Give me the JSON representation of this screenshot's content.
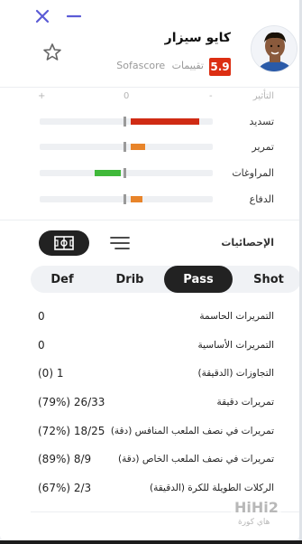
{
  "header": {
    "player_name": "كايو سيزار",
    "rating": "5.9",
    "rating_label": "تقييمات",
    "rating_source": "Sofascore"
  },
  "colors": {
    "rating_badge": "#dc2e12",
    "positive_bar": "#d02b14",
    "mid_bar": "#e8842a",
    "green_bar": "#40b93a",
    "accent": "#5b5bd6"
  },
  "axis": {
    "plus": "+",
    "zero": "0",
    "minus": "-",
    "title": "التأثير"
  },
  "pitch_stats": [
    {
      "label": "تسديد",
      "side": "positive",
      "value": 0.8
    },
    {
      "label": "تمرير",
      "side": "positive",
      "value": 0.17
    },
    {
      "label": "المراوغات",
      "side": "negative",
      "value": 0.3
    },
    {
      "label": "الدفاع",
      "side": "positive",
      "value": 0.14
    }
  ],
  "stats_section": {
    "title": "الإحصائيات",
    "view_toggle": [
      "pitch-view-icon",
      "list-view-icon"
    ]
  },
  "tabs": [
    {
      "label": "Def",
      "active": false
    },
    {
      "label": "Drib",
      "active": false
    },
    {
      "label": "Pass",
      "active": true
    },
    {
      "label": "Shot",
      "active": false
    }
  ],
  "stats": [
    {
      "label": "التمريرات الحاسمة",
      "value": "0"
    },
    {
      "label": "التمريرات الأساسية",
      "value": "0"
    },
    {
      "label": "التجاوزات (الدقيقة)",
      "value": "(0) 1"
    },
    {
      "label": "تمريرات دقيقة",
      "value": "(79%) 26/33"
    },
    {
      "label": "تمريرات في نصف الملعب المنافس (دقة)",
      "value": "(72%) 18/25"
    },
    {
      "label": "تمريرات في نصف الملعب الخاص (دقة)",
      "value": "(89%) 8/9"
    },
    {
      "label": "الركلات الطويلة للكرة (الدقيقة)",
      "value": "(67%) 2/3"
    }
  ],
  "watermark": {
    "logo": "HiHi2",
    "sub": "هاي كورة"
  }
}
